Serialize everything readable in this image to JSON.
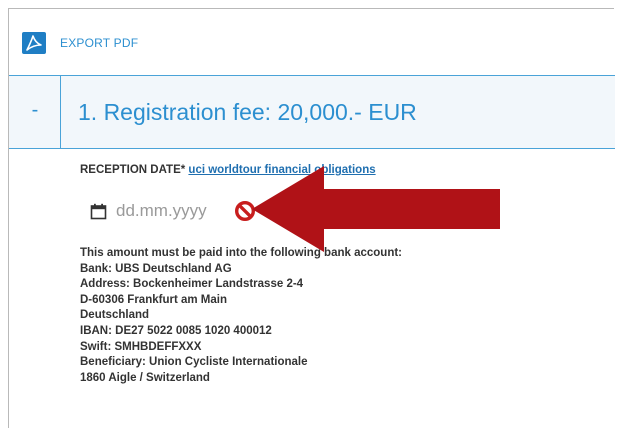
{
  "toolbar": {
    "icon": "pdf-icon",
    "export_label": "EXPORT PDF"
  },
  "section": {
    "toggle": "-",
    "title": "1. Registration fee: 20,000.- EUR"
  },
  "reception": {
    "label": "RECEPTION DATE*",
    "link_text": "uci worldtour financial obligations",
    "placeholder": "dd.mm.yyyy",
    "calendar_icon": "calendar-icon",
    "clear_icon": "no-entry-icon"
  },
  "bank": {
    "lines": [
      "This amount must be paid into the following bank account:",
      "Bank: UBS Deutschland AG",
      "Address: Bockenheimer Landstrasse 2-4",
      "D-60306 Frankfurt am Main",
      "Deutschland",
      "IBAN: DE27 5022 0085 1020 400012",
      "Swift: SMHBDEFFXXX",
      "Beneficiary: Union Cycliste Internationale",
      "1860 Aigle / Switzerland"
    ]
  },
  "colors": {
    "accent": "#2c8fd0",
    "border": "#4aa3d8",
    "header_bg": "#f2f7fb",
    "annotation_arrow": "#b01217",
    "clear_icon": "#c81e1e"
  }
}
